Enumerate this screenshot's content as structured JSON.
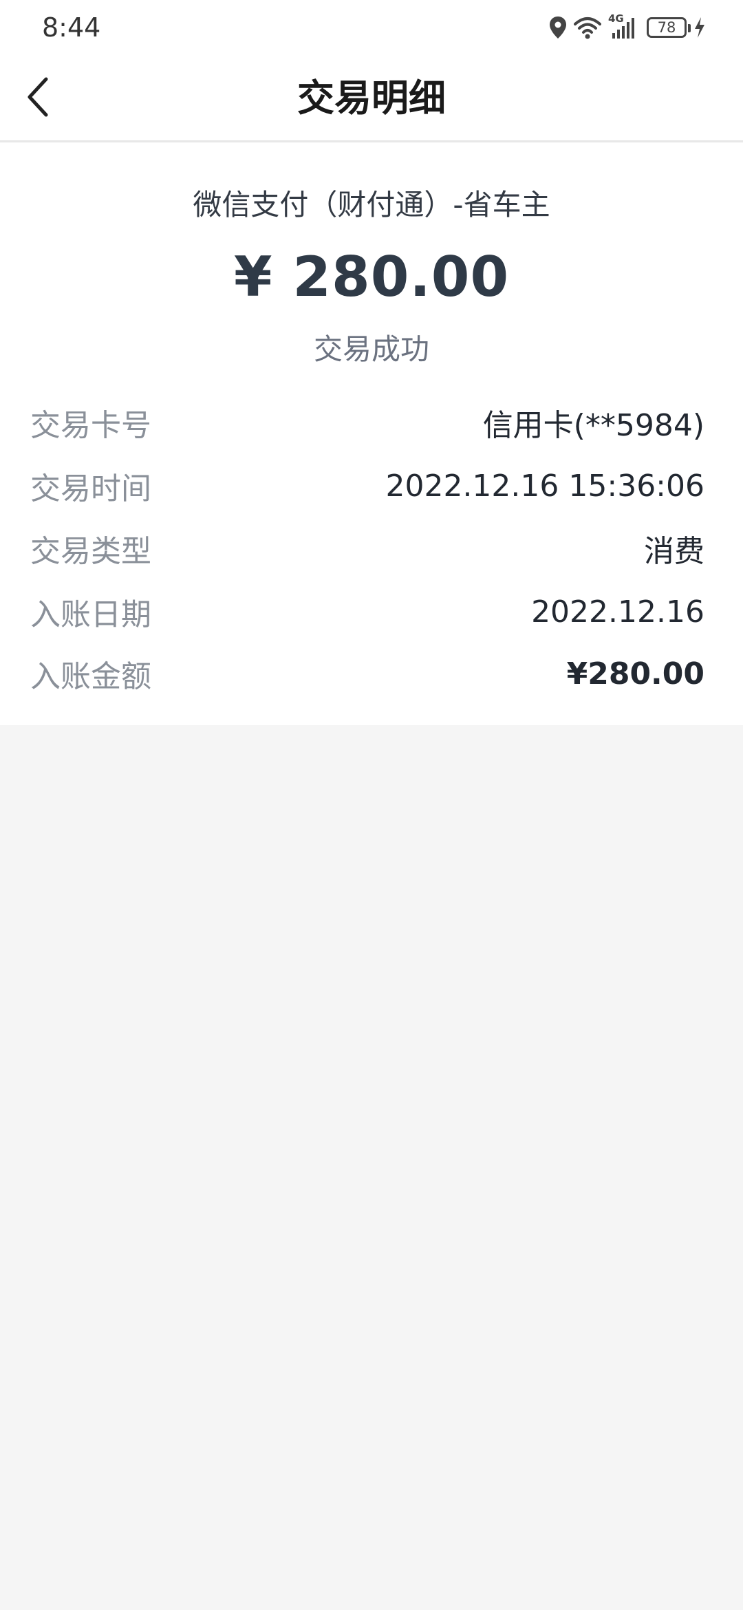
{
  "status_bar": {
    "time": "8:44",
    "network": "4G",
    "battery": "78"
  },
  "nav": {
    "title": "交易明细"
  },
  "transaction": {
    "merchant": "微信支付（财付通）-省车主",
    "amount": "¥ 280.00",
    "status": "交易成功"
  },
  "details": [
    {
      "label": "交易卡号",
      "value": "信用卡(**5984)"
    },
    {
      "label": "交易时间",
      "value": "2022.12.16 15:36:06"
    },
    {
      "label": "交易类型",
      "value": "消费"
    },
    {
      "label": "入账日期",
      "value": "2022.12.16"
    },
    {
      "label": "入账金额",
      "value": "¥280.00"
    }
  ],
  "icons": {
    "back": "chevron-left-icon",
    "location": "location-icon",
    "wifi": "wifi-icon",
    "signal": "signal-icon",
    "battery": "battery-icon",
    "charging": "bolt-icon"
  },
  "colors": {
    "background": "#f5f5f5",
    "card": "#ffffff",
    "amount": "#2f3a47",
    "label": "#8a9099"
  }
}
